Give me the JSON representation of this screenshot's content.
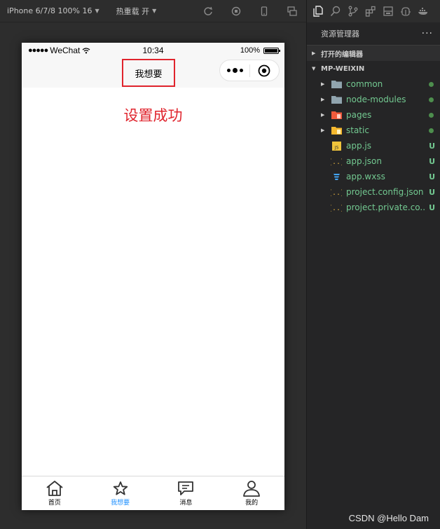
{
  "toolbar": {
    "device_label": "iPhone 6/7/8 100% 16",
    "hot_reload_label": "热重载 开",
    "icons": [
      "compile-icon",
      "stop-icon",
      "phone-preview-icon",
      "copy-icon"
    ]
  },
  "phone": {
    "status_bar": {
      "signal": "●●●●●",
      "carrier": "WeChat",
      "time": "10:34",
      "battery_percent": "100%"
    },
    "nav_title": "我想要",
    "highlight_color": "#e0242d",
    "content_text": "设置成功",
    "tab_bar": {
      "active_color": "#1e90ff",
      "items": [
        {
          "label": "首页",
          "icon": "home-icon"
        },
        {
          "label": "我想要",
          "icon": "star-icon",
          "active": true
        },
        {
          "label": "消息",
          "icon": "message-icon"
        },
        {
          "label": "我的",
          "icon": "user-icon"
        }
      ]
    }
  },
  "explorer": {
    "title": "资源管理器",
    "more": "···",
    "open_editors_label": "打开的编辑器",
    "project_label": "MP-WEIXIN",
    "files": [
      {
        "name": "common",
        "type": "folder",
        "status": "dot"
      },
      {
        "name": "node-modules",
        "type": "folder",
        "status": "dot"
      },
      {
        "name": "pages",
        "type": "folder-pages",
        "status": "dot"
      },
      {
        "name": "static",
        "type": "folder-static",
        "status": "dot"
      },
      {
        "name": "app.js",
        "type": "js",
        "status": "U"
      },
      {
        "name": "app.json",
        "type": "json",
        "status": "U"
      },
      {
        "name": "app.wxss",
        "type": "css",
        "status": "U"
      },
      {
        "name": "project.config.json",
        "type": "json",
        "status": "U"
      },
      {
        "name": "project.private.co...",
        "type": "json",
        "status": "U"
      }
    ]
  },
  "watermark": "CSDN @Hello Dam"
}
